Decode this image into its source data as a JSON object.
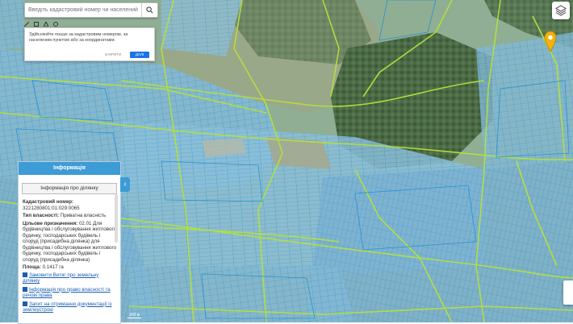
{
  "search": {
    "placeholder": "Введіть кадастровий номер чи населений пункт"
  },
  "tooltip": {
    "text": "Здійсніюйте пошук за кадастровим номером, за населеним пунктом або за координатами.",
    "close_label": "ЗАКРИТИ",
    "confirm_label": "ДАЛІ"
  },
  "panel": {
    "header": "Інформація",
    "subheader": "Інформація про ділянку",
    "cadastral_label": "Кадастровий номер:",
    "cadastral_value": "3221280801:01:029:0065",
    "ownership_label": "Тип власності:",
    "ownership_value": "Приватна власність",
    "purpose_label": "Цільове призначення:",
    "purpose_value": "02.01 Для будівництва і обслуговування житлового будинку, господарських будівель і споруд (присадибна ділянка) для будівництва і обслуговування житлового будинку, господарських будівель і споруд (присадибна ділянка)",
    "area_label": "Площа:",
    "area_value": "0.1417 га",
    "links": [
      "Замовити Витяг про земельну ділянку",
      "Інформація про право власності та речові права",
      "Запит на отримання документації із землеустрою"
    ]
  },
  "map": {
    "scale_label": "200 м",
    "colors": {
      "parcel_fill": "#7fb7d6",
      "parcel_border": "#1e8fd6",
      "road_line": "#b6e03c",
      "forest": "#3d5d3a",
      "field": "#9aa184",
      "pin": "#f2b10c"
    }
  },
  "icons": {
    "search": "search-icon",
    "layers": "layers-icon",
    "pin": "location-pin-icon",
    "collapse": "chevron-left-icon"
  }
}
